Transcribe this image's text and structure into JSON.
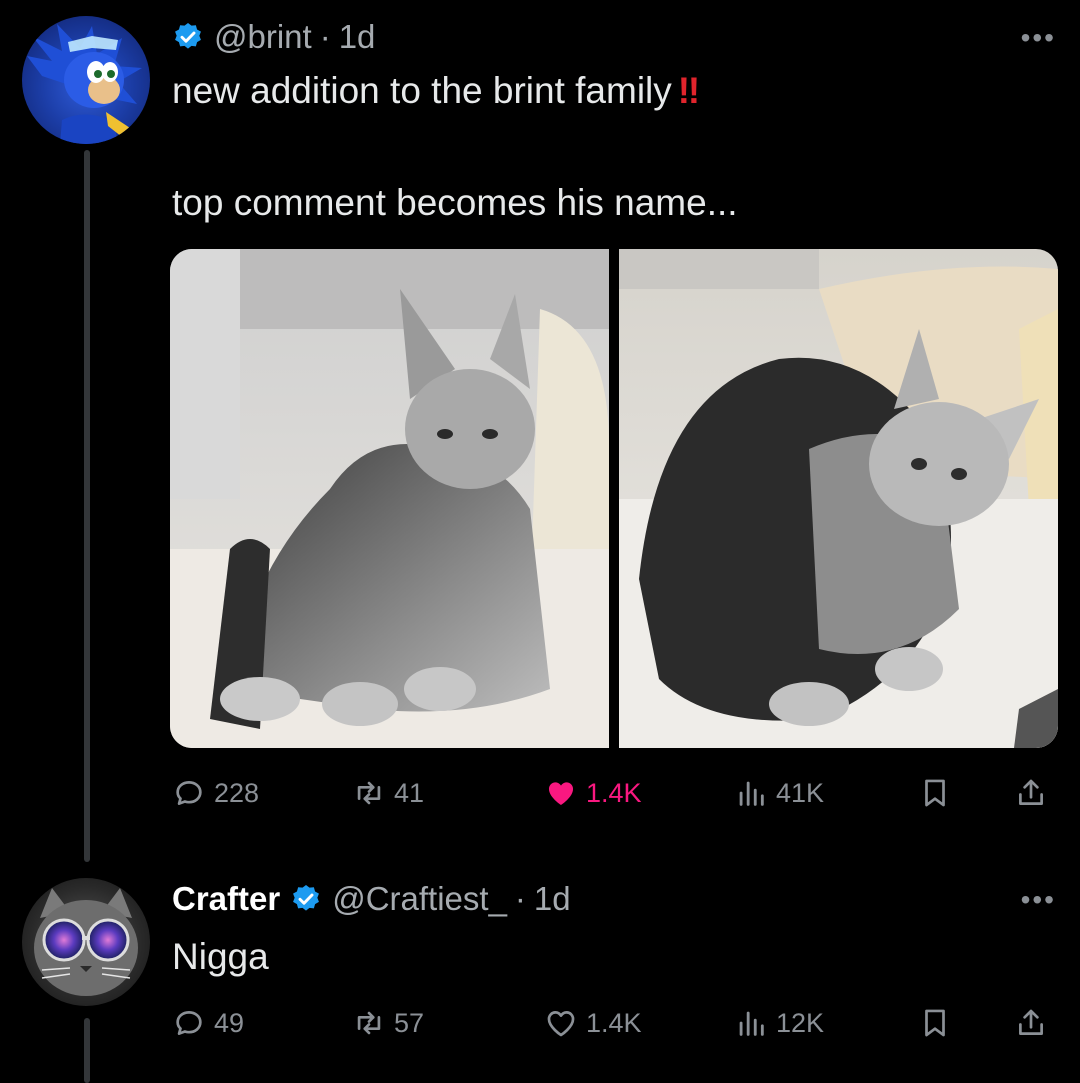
{
  "post": {
    "handle": "@brint",
    "age": "1d",
    "line1": "new addition to the brint family",
    "line1_emoji": "‼",
    "line2": "top comment becomes his name...",
    "replies": "228",
    "reposts": "41",
    "likes": "1.4K",
    "views": "41K",
    "more": "•••"
  },
  "reply": {
    "display_name": "Crafter",
    "handle": "@Craftiest_",
    "age": "1d",
    "text": "Nigga",
    "replies": "49",
    "reposts": "57",
    "likes": "1.4K",
    "views": "12K",
    "more": "•••"
  },
  "separator": "·",
  "colors": {
    "background": "#000000",
    "like": "#f91880",
    "verified": "#1d9bf0",
    "muted": "#8b9096"
  },
  "icons": [
    "verified-badge-icon",
    "reply-icon",
    "repost-icon",
    "like-icon",
    "views-icon",
    "bookmark-icon",
    "share-icon",
    "more-icon"
  ]
}
